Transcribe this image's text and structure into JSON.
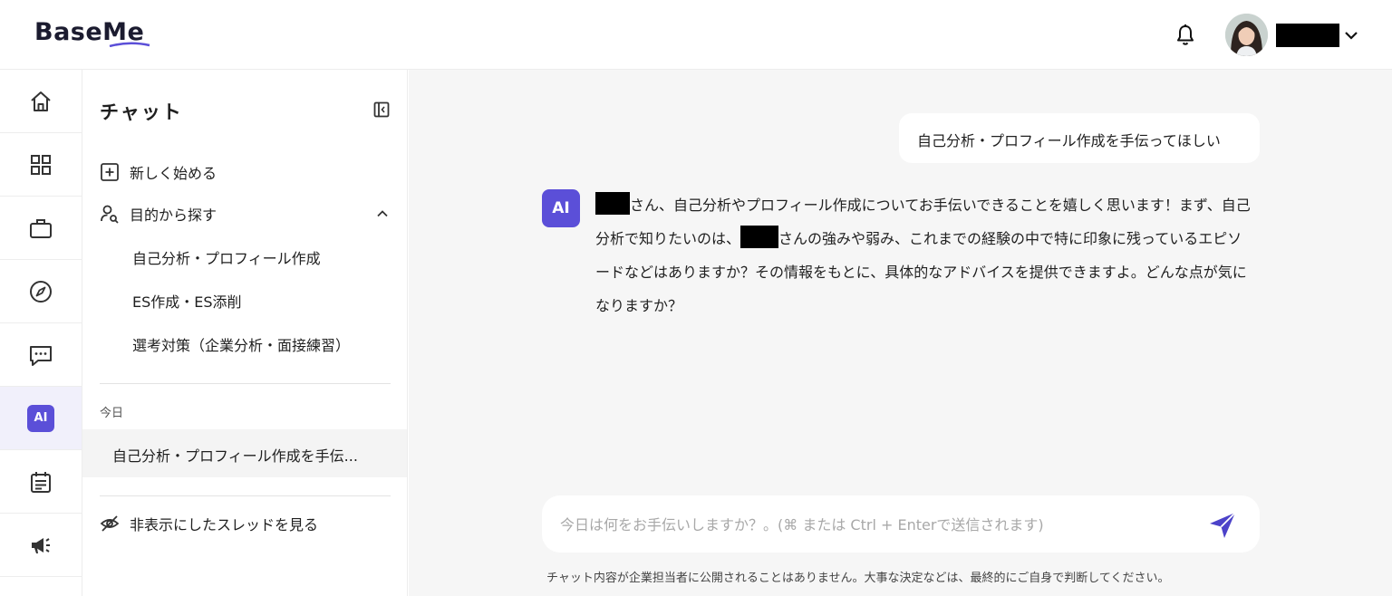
{
  "header": {
    "logo": "BaseMe",
    "bell_icon": "bell-icon",
    "accent": "#5b4fd8"
  },
  "rail": {
    "items": [
      {
        "icon": "home-icon"
      },
      {
        "icon": "grid-icon"
      },
      {
        "icon": "briefcase-icon"
      },
      {
        "icon": "compass-icon"
      },
      {
        "icon": "chat-icon"
      },
      {
        "icon": "ai-icon",
        "label": "AI",
        "active": true
      },
      {
        "icon": "calendar-icon"
      },
      {
        "icon": "megaphone-icon"
      }
    ]
  },
  "sidebar": {
    "title": "チャット",
    "new_chat": "新しく始める",
    "purpose": "目的から探す",
    "purpose_items": [
      "自己分析・プロフィール作成",
      "ES作成・ES添削",
      "選考対策（企業分析・面接練習）"
    ],
    "today_label": "今日",
    "threads": [
      "自己分析・プロフィール作成を手伝..."
    ],
    "hidden_threads": "非表示にしたスレッドを見る"
  },
  "chat": {
    "user_message": "自己分析・プロフィール作成を手伝ってほしい",
    "ai_avatar_label": "AI",
    "ai_message": {
      "part1": "さん、自己分析やプロフィール作成についてお手伝いできることを嬉しく思います！まず、自己分析で知りたいのは、",
      "part2": "さんの強みや弱み、これまでの経験の中で特に印象に残っているエピソードなどはありますか？その情報をもとに、具体的なアドバイスを提供できますよ。どんな点が気になりますか？"
    },
    "input_placeholder": "今日は何をお手伝いしますか？。(⌘ または Ctrl + Enterで送信されます)",
    "disclaimer": "チャット内容が企業担当者に公開されることはありません。大事な決定などは、最終的にご自身で判断してください。"
  }
}
